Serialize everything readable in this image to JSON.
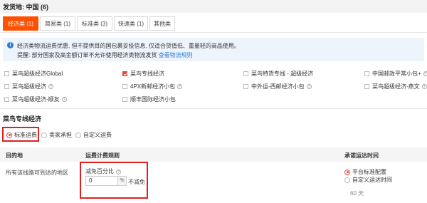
{
  "header": {
    "title": "发货地:  中国 (6)"
  },
  "tabs": [
    {
      "label": "经济类 (1)",
      "active": true
    },
    {
      "label": "简易类 (1)"
    },
    {
      "label": "标准类 (3)"
    },
    {
      "label": "快速类 (1)"
    },
    {
      "label": "其他类"
    }
  ],
  "notice": {
    "line1": "经济类物流运费优惠, 但不提供目的国包裹妥投信息, 仅适合货值低、重量轻的商品使用。",
    "line2_prefix": "提醒: 部分国家及高金额订单不允许使用经济类物流发货",
    "line2_link": "查看物流规则"
  },
  "options": [
    {
      "label": "菜鸟超级经济Global",
      "checked": false
    },
    {
      "label": "菜鸟专线经济",
      "checked": true
    },
    {
      "label": "菜鸟特货专线 - 超级经济",
      "checked": false
    },
    {
      "label": "中国邮政平常小包+",
      "checked": false,
      "help": true
    },
    {
      "label": "菜鸟超级经济",
      "checked": false,
      "help": true
    },
    {
      "label": "4PX新邮经济小包",
      "checked": false,
      "help": true
    },
    {
      "label": "中外运-西邮经济小包",
      "checked": false,
      "help": true
    },
    {
      "label": "菜鸟超级经济-燕文",
      "checked": false,
      "help": true
    },
    {
      "label": "菜鸟超级经济-顺友",
      "checked": false,
      "help": true
    },
    {
      "label": "顺丰国际经济小包",
      "checked": false
    }
  ],
  "section": {
    "title": "菜鸟专线经济",
    "freight_modes": [
      {
        "label": "标准运费",
        "selected": true
      },
      {
        "label": "卖家承担",
        "selected": false
      },
      {
        "label": "自定义运费",
        "selected": false
      }
    ]
  },
  "table": {
    "headers": [
      "目的地",
      "运费计费规则",
      "承诺运达时间"
    ],
    "row": {
      "destination": "所有该线路可到达的地区",
      "discount_label": "减免百分比",
      "discount_value": "0",
      "discount_unit": "%",
      "discount_note": "不减免",
      "delivery_options": [
        {
          "label": "平台标准配置",
          "selected": true
        },
        {
          "label": "自定义运达时间",
          "selected": false
        }
      ],
      "delivery_days": "60 天"
    }
  },
  "colors": {
    "accent": "#ff5000",
    "highlight": "#e02020",
    "link": "#2f7bd8"
  }
}
